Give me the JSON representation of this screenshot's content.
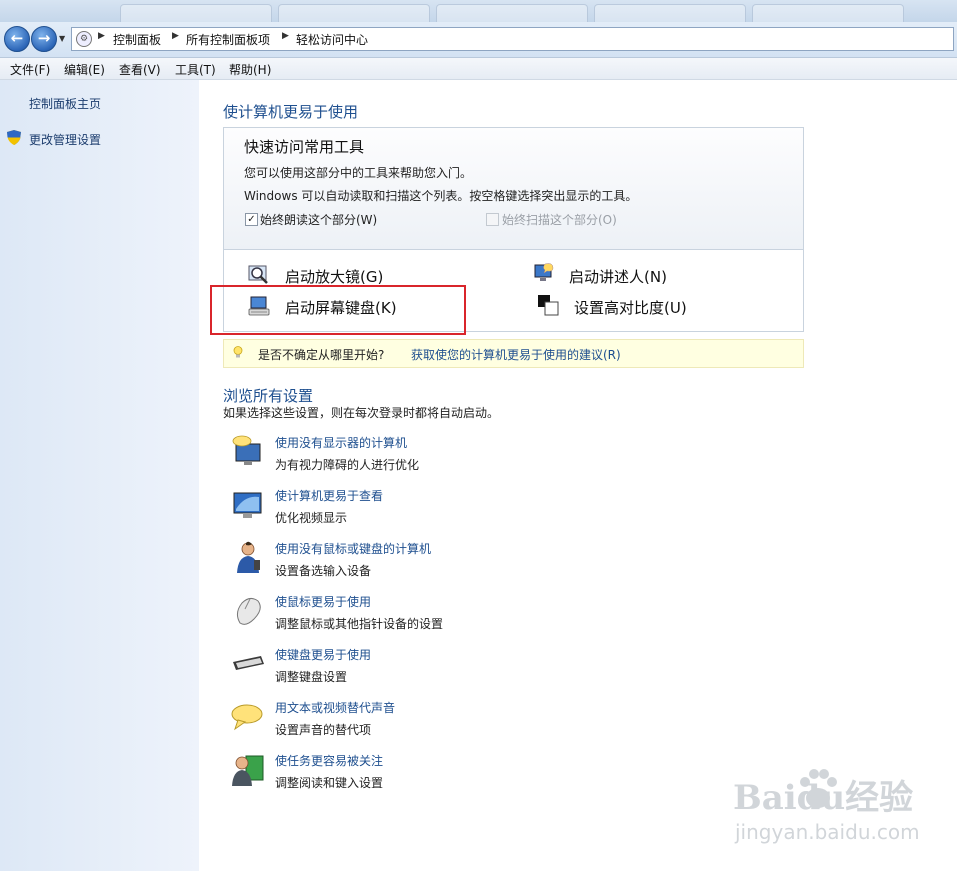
{
  "breadcrumb": [
    "控制面板",
    "所有控制面板项",
    "轻松访问中心"
  ],
  "menu": [
    "文件(F)",
    "编辑(E)",
    "查看(V)",
    "工具(T)",
    "帮助(H)"
  ],
  "left": {
    "home_link": "控制面板主页",
    "admin_link": "更改管理设置"
  },
  "main": {
    "heading": "使计算机更易于使用",
    "quick": {
      "title": "快速访问常用工具",
      "line1": "您可以使用这部分中的工具来帮助您入门。",
      "line2": "Windows 可以自动读取和扫描这个列表。按空格键选择突出显示的工具。",
      "read_label": "始终朗读这个部分(W)",
      "read_checked": true,
      "scan_label": "始终扫描这个部分(O)",
      "scan_checked": false,
      "tools": {
        "magnifier": "启动放大镜(G)",
        "narrator": "启动讲述人(N)",
        "osk": "启动屏幕键盘(K)",
        "contrast": "设置高对比度(U)"
      }
    },
    "tip": {
      "question": "是否不确定从哪里开始?",
      "link": "获取使您的计算机更易于使用的建议(R)"
    },
    "browse": {
      "heading": "浏览所有设置",
      "subtitle": "如果选择这些设置，则在每次登录时都将自动启动。",
      "items": [
        {
          "icon": "monitor-speech-icon",
          "link": "使用没有显示器的计算机",
          "desc": "为有视力障碍的人进行优化"
        },
        {
          "icon": "display-icon",
          "link": "使计算机更易于查看",
          "desc": "优化视频显示"
        },
        {
          "icon": "person-icon",
          "link": "使用没有鼠标或键盘的计算机",
          "desc": "设置备选输入设备"
        },
        {
          "icon": "mouse-icon",
          "link": "使鼠标更易于使用",
          "desc": "调整鼠标或其他指针设备的设置"
        },
        {
          "icon": "keyboard-icon",
          "link": "使键盘更易于使用",
          "desc": "调整键盘设置"
        },
        {
          "icon": "speech-bubble-icon",
          "link": "用文本或视频替代声音",
          "desc": "设置声音的替代项"
        },
        {
          "icon": "focus-person-icon",
          "link": "使任务更容易被关注",
          "desc": "调整阅读和键入设置"
        }
      ]
    }
  },
  "watermark": {
    "line1": "Baidu经验",
    "line2": "jingyan.baidu.com"
  },
  "colors": {
    "link": "#1e4f8f",
    "highlight": "#d9252b",
    "tip_bg": "#ffffe1"
  }
}
